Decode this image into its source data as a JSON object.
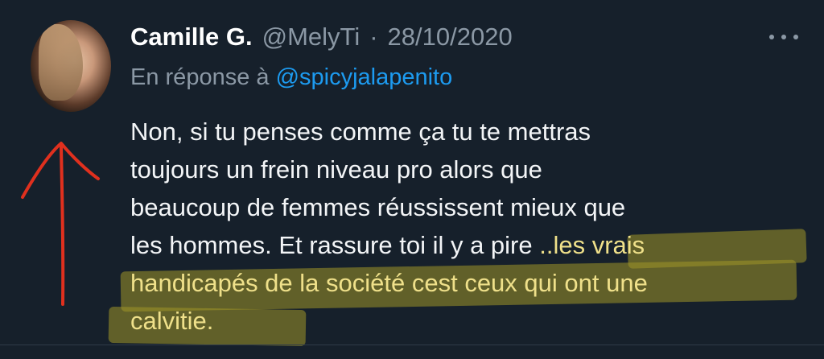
{
  "tweet": {
    "author": {
      "display_name": "Camille G.",
      "handle": "@MelyTi",
      "separator": "·",
      "date": "28/10/2020"
    },
    "reply_prefix": "En réponse à",
    "reply_mention": "@spicyjalapenito",
    "more_icon": "more-horizontal-icon",
    "text": {
      "line1": "Non, si tu penses comme ça tu te mettras",
      "line2": "toujours un frein niveau pro alors que",
      "line3": "beaucoup de femmes réussissent mieux que",
      "line4_plain": "les hommes. Et rassure toi il y a pire",
      "line4_highlight": " ..les vrais",
      "line5": "handicapés de la société cest ceux qui ont une",
      "line6": "calvitie."
    }
  },
  "colors": {
    "background": "#16202b",
    "name": "#ffffff",
    "secondary": "#8b98a5",
    "mention": "#1d9bf0",
    "highlight": "#efe08a",
    "annotation_arrow": "#e0301e"
  }
}
